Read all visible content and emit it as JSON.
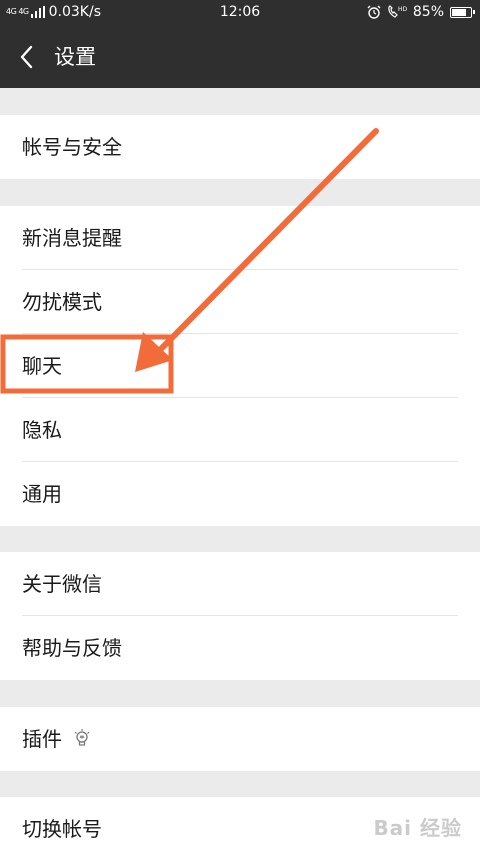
{
  "status_bar": {
    "network_label": "4G 4G",
    "speed": "0.03K/s",
    "time": "12:06",
    "battery_text": "85%",
    "battery_level": 0.85,
    "icons": [
      "signal-icon",
      "alarm-icon",
      "hd-call-icon",
      "battery-icon"
    ]
  },
  "nav": {
    "title": "设置",
    "back_icon": "chevron-left-icon"
  },
  "groups": [
    {
      "items": [
        "帐号与安全"
      ]
    },
    {
      "items": [
        "新消息提醒",
        "勿扰模式",
        "聊天",
        "隐私",
        "通用"
      ]
    },
    {
      "items": [
        "关于微信",
        "帮助与反馈"
      ]
    },
    {
      "items": [
        "插件"
      ]
    },
    {
      "items": [
        "切换帐号"
      ]
    }
  ],
  "annotation": {
    "color": "#f26b3a",
    "highlighted_item": "聊天"
  },
  "watermark": {
    "text": "Bai 经验"
  },
  "colors": {
    "bar_background": "#2f2f2f",
    "page_background": "#ebebeb",
    "row_background": "#ffffff",
    "text": "#1a1a1a",
    "divider": "#e4e4e4"
  }
}
